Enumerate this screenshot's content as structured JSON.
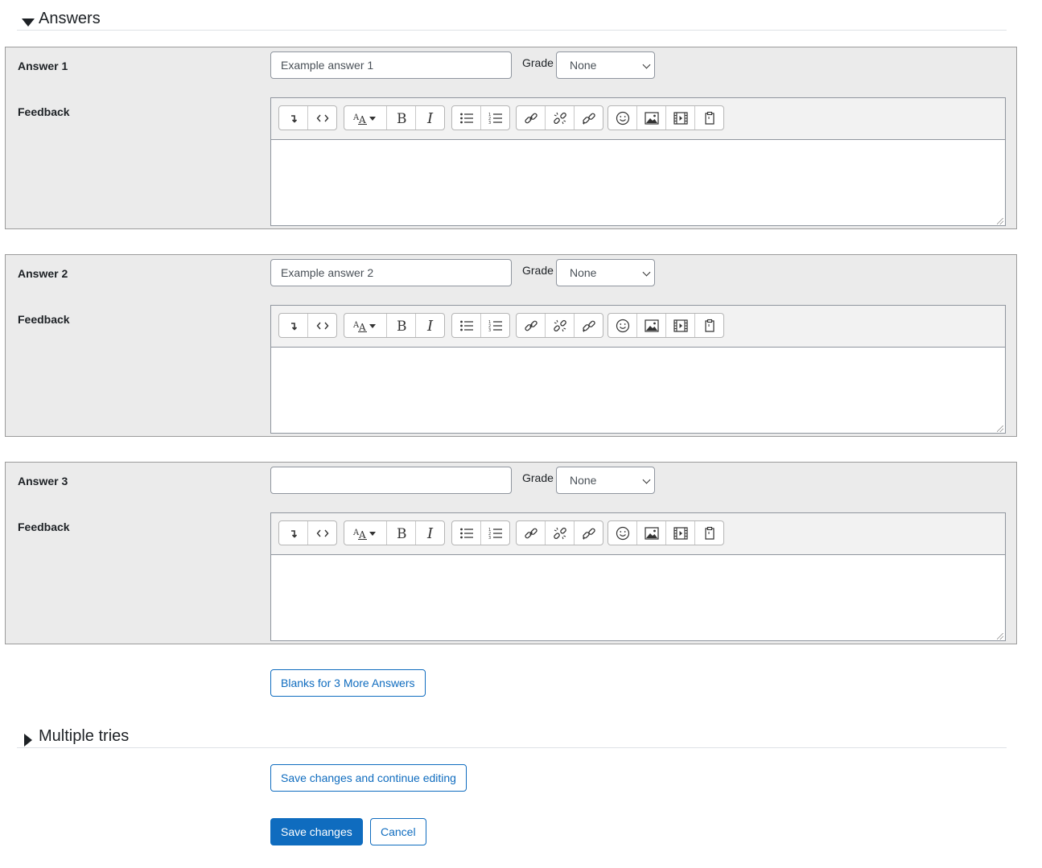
{
  "sections": {
    "answers_title": "Answers",
    "multiple_tries_title": "Multiple tries"
  },
  "answers": [
    {
      "label": "Answer 1",
      "value": "Example answer 1",
      "grade_label": "Grade",
      "grade": "None",
      "feedback_label": "Feedback"
    },
    {
      "label": "Answer 2",
      "value": "Example answer 2",
      "grade_label": "Grade",
      "grade": "None",
      "feedback_label": "Feedback"
    },
    {
      "label": "Answer 3",
      "value": "",
      "grade_label": "Grade",
      "grade": "None",
      "feedback_label": "Feedback"
    }
  ],
  "toolbar_icons": [
    [
      "collapse-icon",
      "html-icon"
    ],
    [
      "font-style-icon",
      "bold-icon",
      "italic-icon"
    ],
    [
      "bullet-list-icon",
      "numbered-list-icon"
    ],
    [
      "link-icon",
      "unlink-icon",
      "auto-link-icon"
    ],
    [
      "emoji-icon",
      "image-icon",
      "media-icon",
      "paste-icon"
    ]
  ],
  "buttons": {
    "blanks": "Blanks for 3 More Answers",
    "save_continue": "Save changes and continue editing",
    "save": "Save changes",
    "cancel": "Cancel"
  },
  "colors": {
    "primary": "#0f6cbf",
    "panel_bg": "#ebebeb"
  }
}
